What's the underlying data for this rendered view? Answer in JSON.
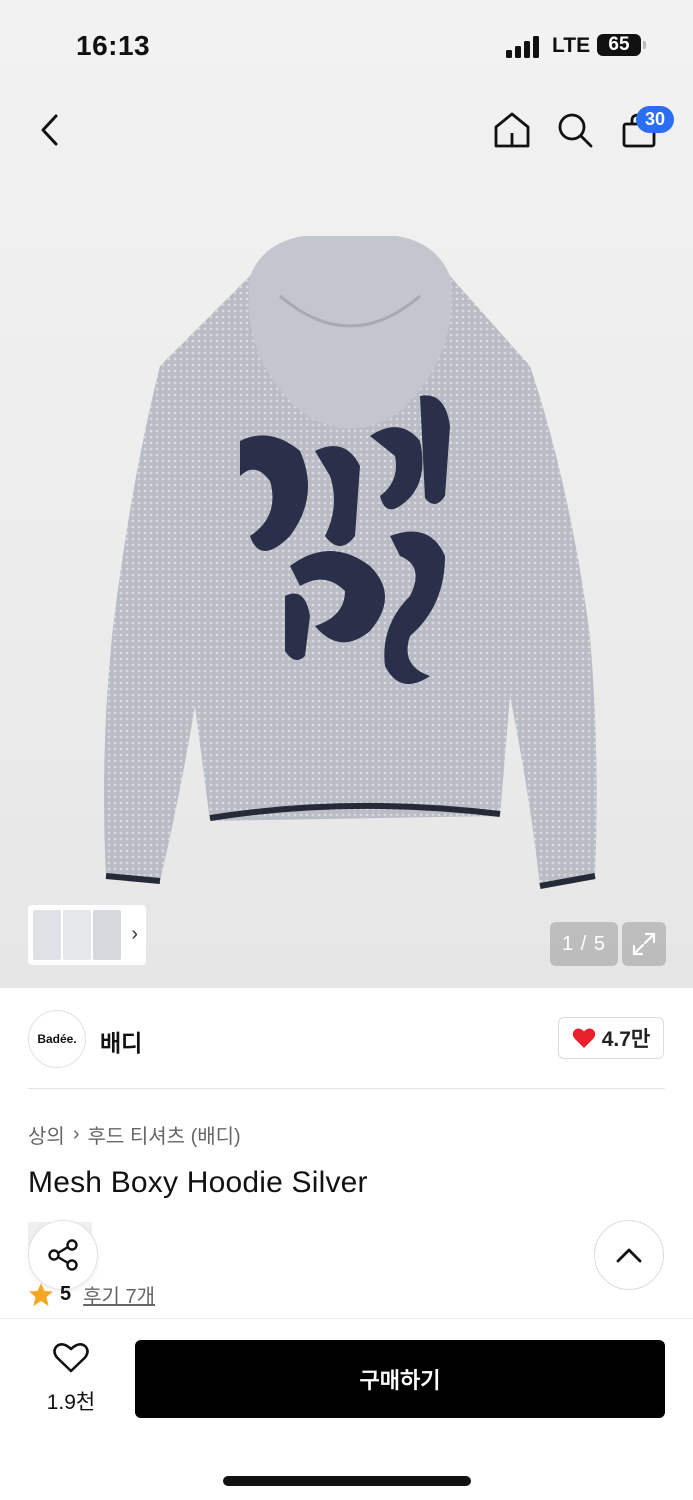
{
  "status": {
    "time": "16:13",
    "network": "LTE",
    "battery": "65"
  },
  "header": {
    "back_icon": "chevron-left-icon",
    "home_icon": "home-icon",
    "search_icon": "search-icon",
    "cart_icon": "shopping-bag-icon",
    "cart_count": "30"
  },
  "gallery": {
    "pager": "1 / 5",
    "expand_icon": "expand-icon",
    "thumbnails_icon": "chevron-right-icon"
  },
  "brand": {
    "logo_text": "Badée.",
    "name": "배디",
    "likes": "4.7만",
    "likes_icon": "heart-filled-icon"
  },
  "product": {
    "breadcrumb": [
      "상의",
      "후드 티셔츠 (배디)"
    ],
    "title": "Mesh Boxy Hoodie Silver",
    "rating": "5",
    "reviews": "후기 7개"
  },
  "actions": {
    "share_icon": "share-icon",
    "scroll_top_icon": "chevron-up-icon",
    "wishlist_count": "1.9천",
    "buy_label": "구매하기"
  },
  "colors": {
    "accent_blue": "#2b6ef2",
    "heart_red": "#e8202b",
    "star_orange": "#f5a623",
    "buy_button": "#000000"
  }
}
